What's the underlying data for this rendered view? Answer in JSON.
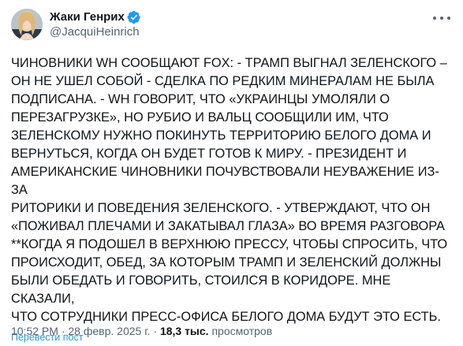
{
  "author": {
    "display_name": "Жаки Генрих",
    "handle": "@JacquiHeinrich",
    "verified": true
  },
  "tweet": {
    "text": "ЧИНОВНИКИ WH СООБЩАЮТ FOX: - ТРАМП ВЫГНАЛ ЗЕЛЕНСКОГО –\nОН НЕ УШЕЛ СОБОЙ - СДЕЛКА ПО РЕДКИМ МИНЕРАЛАМ НЕ БЫЛА\nПОДПИСАНА. - WH ГОВОРИТ, ЧТО «УКРАИНЦЫ УМОЛЯЛИ О\nПЕРЕЗАГРУЗКЕ», НО РУБИО И ВАЛЬЦ СООБЩИЛИ ИМ, ЧТО\nЗЕЛЕНСКОМУ НУЖНО ПОКИНУТЬ ТЕРРИТОРИЮ БЕЛОГО ДОМА И\nВЕРНУТЬСЯ, КОГДА ОН БУДЕТ ГОТОВ К МИРУ. - ПРЕЗИДЕНТ И\nАМЕРИКАНСКИЕ ЧИНОВНИКИ ПОЧУВСТВОВАЛИ НЕУВАЖЕНИЕ ИЗ-ЗА\nРИТОРИКИ И ПОВЕДЕНИЯ ЗЕЛЕНСКОГО. - УТВЕРЖДАЮТ, ЧТО ОН\n«ПОЖИВАЛ ПЛЕЧАМИ И ЗАКАТЫВАЛ ГЛАЗА» ВО ВРЕМЯ РАЗГОВОРА\n**КОГДА Я ПОДОШЕЛ В ВЕРХНЮЮ ПРЕССУ, ЧТОБЫ СПРОСИТЬ, ЧТО\nПРОИСХОДИТ, ОБЕД, ЗА КОТОРЫМ ТРАМП И ЗЕЛЕНСКИЙ ДОЛЖНЫ\nБЫЛИ ОБЕДАТЬ И ГОВОРИТЬ, СТОИЛСЯ В КОРИДОРЕ. МНЕ СКАЗАЛИ,\nЧТО СОТРУДНИКИ ПРЕСС-ОФИСА БЕЛОГО ДОМА БУДУТ ЭТО ЕСТЬ.",
    "translate_label": "Перевести пост"
  },
  "meta": {
    "time": "10:52 PM",
    "separator": " · ",
    "date": "28 февр. 2025 г.",
    "views_count": "18,3 тыс.",
    "views_label": "просмотров"
  },
  "colors": {
    "link": "#1d9bf0",
    "secondary_text": "#536471",
    "primary_text": "#0f1419",
    "verified_badge": "#1d9bf0"
  },
  "icons": {
    "verified": "verified-badge-icon",
    "more": "more-options-icon"
  }
}
